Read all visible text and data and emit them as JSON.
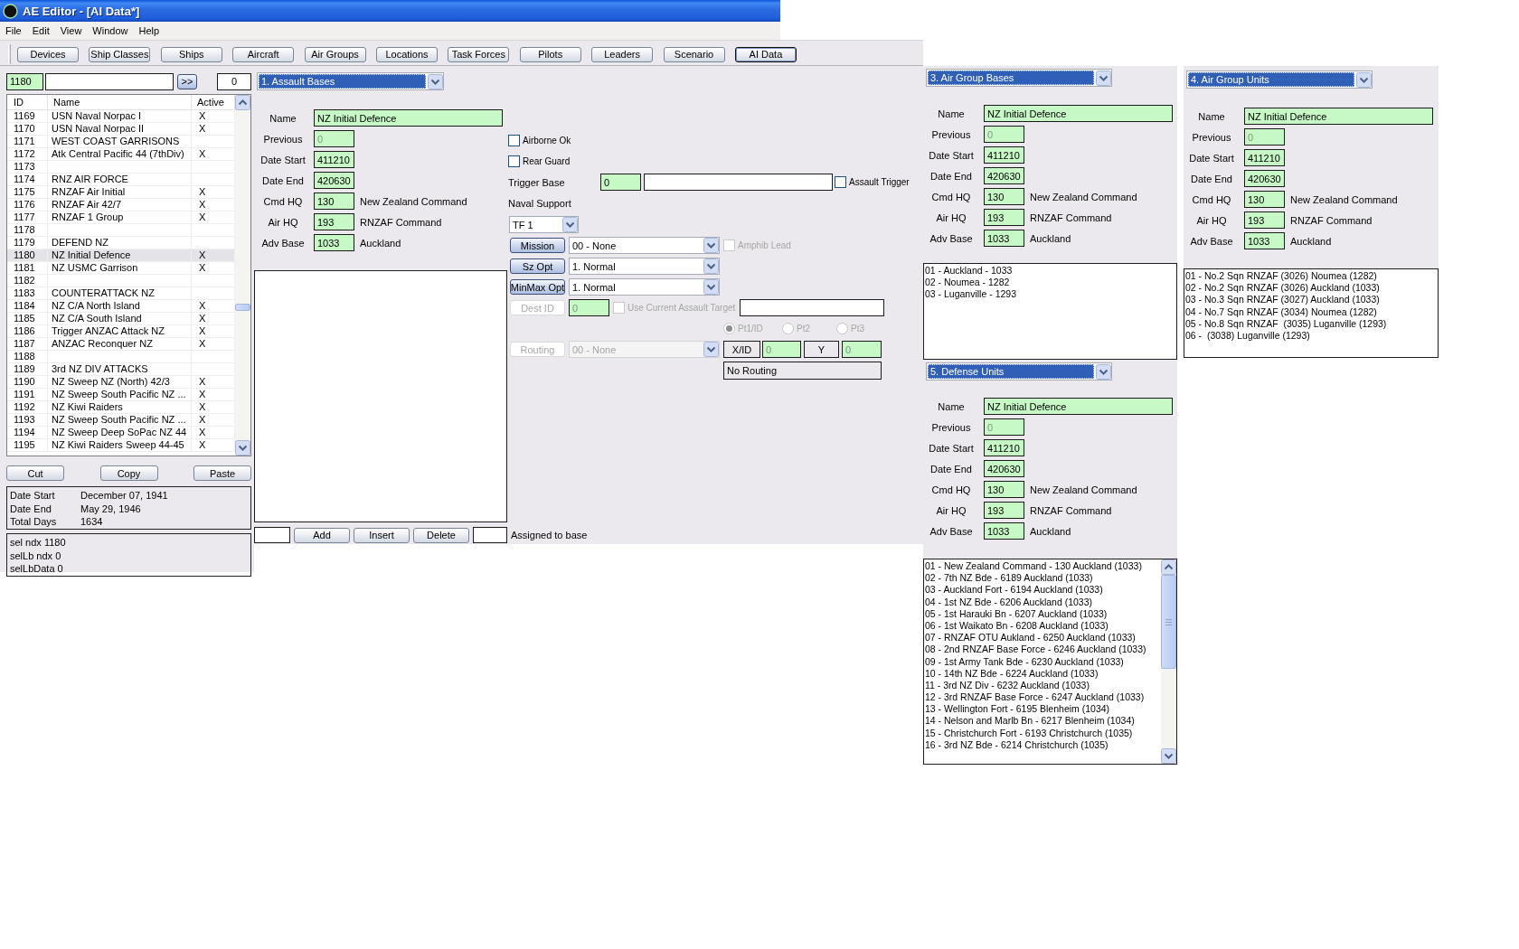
{
  "window": {
    "title": "AE Editor - [AI Data*]"
  },
  "menu": [
    "File",
    "Edit",
    "View",
    "Window",
    "Help"
  ],
  "toolbar": [
    {
      "label": "Devices",
      "selected": false
    },
    {
      "label": "Ship Classes",
      "selected": false
    },
    {
      "label": "Ships",
      "selected": false
    },
    {
      "label": "Aircraft",
      "selected": false
    },
    {
      "label": "Air Groups",
      "selected": false
    },
    {
      "label": "Locations",
      "selected": false
    },
    {
      "label": "Task Forces",
      "selected": false
    },
    {
      "label": "Pilots",
      "selected": false
    },
    {
      "label": "Leaders",
      "selected": false
    },
    {
      "label": "Scenario",
      "selected": false
    },
    {
      "label": "AI Data",
      "selected": true
    }
  ],
  "record_bar": {
    "id_value": "1180",
    "go_button": ">>",
    "count_value": "0"
  },
  "record_list": {
    "columns": [
      "ID",
      "Name",
      "Active"
    ],
    "rows": [
      {
        "id": "1169",
        "name": "USN Naval Norpac I",
        "active": "X",
        "selected": false
      },
      {
        "id": "1170",
        "name": "USN Naval Norpac II",
        "active": "X",
        "selected": false
      },
      {
        "id": "1171",
        "name": "WEST COAST GARRISONS",
        "selected": false
      },
      {
        "id": "1172",
        "name": "Atk Central Pacific 44 (7thDiv)",
        "active": "X",
        "selected": false
      },
      {
        "id": "1173",
        "selected": false
      },
      {
        "id": "1174",
        "name": "RNZ AIR FORCE",
        "selected": false
      },
      {
        "id": "1175",
        "name": "RNZAF Air Initial",
        "active": "X",
        "selected": false
      },
      {
        "id": "1176",
        "name": "RNZAF Air 42/7",
        "active": "X",
        "selected": false
      },
      {
        "id": "1177",
        "name": "RNZAF 1 Group",
        "active": "X",
        "selected": false
      },
      {
        "id": "1178",
        "selected": false
      },
      {
        "id": "1179",
        "name": "DEFEND NZ",
        "selected": false
      },
      {
        "id": "1180",
        "name": "NZ Initial Defence",
        "active": "X",
        "selected": true
      },
      {
        "id": "1181",
        "name": "NZ USMC Garrison",
        "active": "X",
        "selected": false
      },
      {
        "id": "1182",
        "selected": false
      },
      {
        "id": "1183",
        "name": "COUNTERATTACK NZ",
        "selected": false
      },
      {
        "id": "1184",
        "name": "NZ C/A North Island",
        "active": "X",
        "selected": false
      },
      {
        "id": "1185",
        "name": "NZ C/A South Island",
        "active": "X",
        "selected": false
      },
      {
        "id": "1186",
        "name": "Trigger ANZAC Attack NZ",
        "active": "X",
        "selected": false
      },
      {
        "id": "1187",
        "name": "ANZAC Reconquer NZ",
        "active": "X",
        "selected": false
      },
      {
        "id": "1188",
        "selected": false
      },
      {
        "id": "1189",
        "name": "3rd NZ DIV ATTACKS",
        "selected": false
      },
      {
        "id": "1190",
        "name": "NZ Sweep NZ (North) 42/3",
        "active": "X",
        "selected": false
      },
      {
        "id": "1191",
        "name": "NZ Sweep South Pacific NZ ...",
        "active": "X",
        "selected": false
      },
      {
        "id": "1192",
        "name": "NZ Kiwi Raiders",
        "active": "X",
        "selected": false
      },
      {
        "id": "1193",
        "name": "NZ Sweep South Pacific NZ ...",
        "active": "X",
        "selected": false
      },
      {
        "id": "1194",
        "name": "NZ Sweep Deep SoPac NZ 44",
        "active": "X",
        "selected": false
      },
      {
        "id": "1195",
        "name": "NZ Kiwi Raiders Sweep 44-45",
        "active": "X",
        "selected": false
      }
    ]
  },
  "list_buttons": [
    "Cut",
    "Copy",
    "Paste"
  ],
  "summary": [
    {
      "label": "Date Start",
      "value": "December 07, 1941"
    },
    {
      "label": "Date End",
      "value": "May 29, 1946"
    },
    {
      "label": "Total Days",
      "value": "1634"
    }
  ],
  "debug_lines": [
    "sel ndx 1180",
    "selLb ndx 0",
    "selLbData 0"
  ],
  "assault_bases": {
    "select": "1. Assault Bases",
    "fields": [
      {
        "label": "Name",
        "value": "NZ Initial Defence",
        "kind": "wide",
        "disabled": false
      },
      {
        "label": "Previous",
        "value": "0",
        "kind": "short",
        "disabled": true
      },
      {
        "label": "Date Start",
        "value": "411210",
        "kind": "short",
        "disabled": false
      },
      {
        "label": "Date End",
        "value": "420630",
        "kind": "short",
        "disabled": false
      },
      {
        "label": "Cmd HQ",
        "value": "130",
        "kind": "short",
        "disabled": false,
        "note": "New Zealand Command"
      },
      {
        "label": "Air HQ",
        "value": "193",
        "kind": "short",
        "disabled": false,
        "note": "RNZAF Command"
      },
      {
        "label": "Adv Base",
        "value": "1033",
        "kind": "short",
        "disabled": false,
        "note": "Auckland"
      }
    ],
    "entry_buttons": [
      "Add",
      "Insert",
      "Delete"
    ],
    "assigned_label": "Assigned to base"
  },
  "options": {
    "checkboxes": [
      {
        "label": "Airborne Ok",
        "checked": false
      },
      {
        "label": "Rear Guard",
        "checked": false
      }
    ],
    "trigger": {
      "label": "Trigger Base",
      "value": "0",
      "checkbox": {
        "label": "Assault Trigger",
        "checked": false
      }
    },
    "naval_support": {
      "label": "Naval Support",
      "value": "TF 1"
    },
    "rows": [
      {
        "button": "Mission",
        "value": "00 - None",
        "disabled": false,
        "checkbox": {
          "label": "Amphib Lead",
          "checked": false,
          "disabled": true
        }
      },
      {
        "button": "Sz Opt",
        "value": "1. Normal",
        "disabled": false
      },
      {
        "button": "MinMax Opt",
        "value": "1. Normal",
        "disabled": false
      }
    ],
    "dest": {
      "button": "Dest ID",
      "value": "0",
      "disabled": true,
      "checkbox": {
        "label": "Use Current Assault Target",
        "checked": false,
        "disabled": true
      }
    },
    "points": [
      {
        "label": "Pt1/ID",
        "selected": true,
        "disabled": true
      },
      {
        "label": "Pt2",
        "selected": false,
        "disabled": true
      },
      {
        "label": "Pt3",
        "selected": false,
        "disabled": true
      }
    ],
    "routing": {
      "button": "Routing",
      "value": "00 - None",
      "disabled": true,
      "x_label": "X/ID",
      "x_value": "0",
      "y_label": "Y",
      "y_value": "0",
      "status": "No Routing"
    }
  },
  "panels": [
    {
      "select": "3. Air Group Bases",
      "fields": [
        {
          "label": "Name",
          "value": "NZ Initial Defence",
          "kind": "wide",
          "disabled": false
        },
        {
          "label": "Previous",
          "value": "0",
          "kind": "short",
          "disabled": true
        },
        {
          "label": "Date Start",
          "value": "411210",
          "kind": "short",
          "disabled": false
        },
        {
          "label": "Date End",
          "value": "420630",
          "kind": "short",
          "disabled": false
        },
        {
          "label": "Cmd HQ",
          "value": "130",
          "kind": "short",
          "disabled": false,
          "note": "New Zealand Command"
        },
        {
          "label": "Air HQ",
          "value": "193",
          "kind": "short",
          "disabled": false,
          "note": "RNZAF Command"
        },
        {
          "label": "Adv Base",
          "value": "1033",
          "kind": "short",
          "disabled": false,
          "note": "Auckland"
        }
      ],
      "items": [
        "01 - Auckland - 1033",
        "02 - Noumea - 1282",
        "03 - Luganville - 1293"
      ]
    },
    {
      "select": "4. Air Group Units",
      "fields": [
        {
          "label": "Name",
          "value": "NZ Initial Defence",
          "kind": "wide",
          "disabled": false
        },
        {
          "label": "Previous",
          "value": "0",
          "kind": "short",
          "disabled": true
        },
        {
          "label": "Date Start",
          "value": "411210",
          "kind": "short",
          "disabled": false
        },
        {
          "label": "Date End",
          "value": "420630",
          "kind": "short",
          "disabled": false
        },
        {
          "label": "Cmd HQ",
          "value": "130",
          "kind": "short",
          "disabled": false,
          "note": "New Zealand Command"
        },
        {
          "label": "Air HQ",
          "value": "193",
          "kind": "short",
          "disabled": false,
          "note": "RNZAF Command"
        },
        {
          "label": "Adv Base",
          "value": "1033",
          "kind": "short",
          "disabled": false,
          "note": "Auckland"
        }
      ],
      "items": [
        "01 - No.2 Sqn RNZAF (3026) Noumea (1282)",
        "02 - No.2 Sqn RNZAF (3026) Auckland (1033)",
        "03 - No.3 Sqn RNZAF (3027) Auckland (1033)",
        "04 - No.7 Sqn RNZAF (3034) Noumea (1282)",
        "05 - No.8 Sqn RNZAF  (3035) Luganville (1293)",
        "06 -  (3038) Luganville (1293)"
      ]
    },
    {
      "select": "5. Defense Units",
      "fields": [
        {
          "label": "Name",
          "value": "NZ Initial Defence",
          "kind": "wide",
          "disabled": false
        },
        {
          "label": "Previous",
          "value": "0",
          "kind": "short",
          "disabled": true
        },
        {
          "label": "Date Start",
          "value": "411210",
          "kind": "short",
          "disabled": false
        },
        {
          "label": "Date End",
          "value": "420630",
          "kind": "short",
          "disabled": false
        },
        {
          "label": "Cmd HQ",
          "value": "130",
          "kind": "short",
          "disabled": false,
          "note": "New Zealand Command"
        },
        {
          "label": "Air HQ",
          "value": "193",
          "kind": "short",
          "disabled": false,
          "note": "RNZAF Command"
        },
        {
          "label": "Adv Base",
          "value": "1033",
          "kind": "short",
          "disabled": false,
          "note": "Auckland"
        }
      ],
      "items": [
        "01 - New Zealand Command - 130 Auckland (1033)",
        "02 - 7th NZ Bde - 6189 Auckland (1033)",
        "03 - Auckland Fort - 6194 Auckland (1033)",
        "04 - 1st NZ Bde - 6206 Auckland (1033)",
        "05 - 1st Harauki Bn - 6207 Auckland (1033)",
        "06 - 1st Waikato Bn - 6208 Auckland (1033)",
        "07 - RNZAF OTU Aukland - 6250 Auckland (1033)",
        "08 - 2nd RNZAF Base Force - 6246 Auckland (1033)",
        "09 - 1st Army Tank Bde - 6230 Auckland (1033)",
        "10 - 14th NZ Bde - 6224 Auckland (1033)",
        "11 - 3rd NZ Div - 6232 Auckland (1033)",
        "12 - 3rd RNZAF Base Force - 6247 Auckland (1033)",
        "13 - Wellington Fort - 6195 Blenheim (1034)",
        "14 - Nelson and Marlb Bn - 6217 Blenheim (1034)",
        "15 - Christchurch Fort - 6193 Christchurch (1035)",
        "16 - 3rd NZ Bde - 6214 Christchurch (1035)"
      ]
    }
  ]
}
